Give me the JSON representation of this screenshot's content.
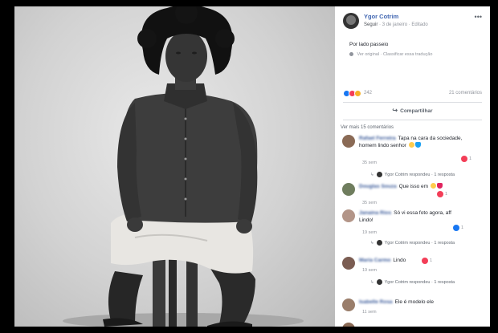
{
  "post": {
    "author": "Ygor Cotrim",
    "follow": "Seguir",
    "date": "3 de janeiro",
    "edited": "Editado",
    "text": "Por lado passeio",
    "see_original": "Ver original",
    "rate_translation": "Classificar essa tradução",
    "reaction_count": "242",
    "comment_count": "21 comentários",
    "share_label": "Compartilhar"
  },
  "comments_section": {
    "view_more": "Ver mais 15 comentários",
    "items": [
      {
        "name": "Rafael Ferreira",
        "text": "Tapa na cara da sociedade, homem lindo senhor",
        "time": "35 sem",
        "reactions": "1",
        "reply_author": "Ygor Cotrim respondeu",
        "reply_count": "1 resposta"
      },
      {
        "name": "Douglas Souza",
        "text": "Que isso em",
        "time": "35 sem",
        "reactions": "1"
      },
      {
        "name": "Janaina Rios",
        "text": "Só vi essa foto agora, aff Lindo!",
        "time": "19 sem",
        "reactions": "1",
        "reply_author": "Ygor Cotrim respondeu",
        "reply_count": "1 resposta"
      },
      {
        "name": "Maria Carmo",
        "text": "Lindo",
        "time": "19 sem",
        "reactions": "1",
        "reply_author": "Ygor Cotrim respondeu",
        "reply_count": "1 resposta"
      },
      {
        "name": "Isabelle Rosa",
        "text": "Ele é modelo ele",
        "time": "11 sem"
      }
    ]
  },
  "colors": {
    "link": "#385898",
    "muted": "#90949c",
    "like": "#1877f2",
    "love": "#f33e58"
  }
}
